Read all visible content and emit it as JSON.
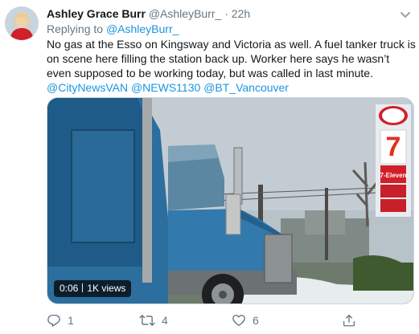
{
  "tweet": {
    "author_name": "Ashley Grace Burr",
    "author_handle": "@AshleyBurr_",
    "separator": "·",
    "time": "22h",
    "reply_prefix": "Replying to",
    "reply_to": "@AshleyBurr_",
    "text": "No gas at the Esso on Kingsway and Victoria as well. A fuel tanker truck is on scene here filling the station back up. Worker here says he wasn’t even supposed to be working today, but was called in last minute.",
    "mentions": [
      "@CityNewsVAN",
      "@NEWS1130",
      "@BT_Vancouver"
    ]
  },
  "media": {
    "type": "video",
    "duration": "0:06",
    "views": "1K views",
    "sign_text": "7-Eleven"
  },
  "actions": {
    "reply_count": "1",
    "retweet_count": "4",
    "like_count": "6"
  },
  "icons": {
    "reply": "reply-icon",
    "retweet": "retweet-icon",
    "like": "heart-icon",
    "share": "share-icon",
    "more": "chevron-down-icon"
  },
  "colors": {
    "link": "#1b95e0",
    "muted": "#657786",
    "text": "#14171a"
  }
}
